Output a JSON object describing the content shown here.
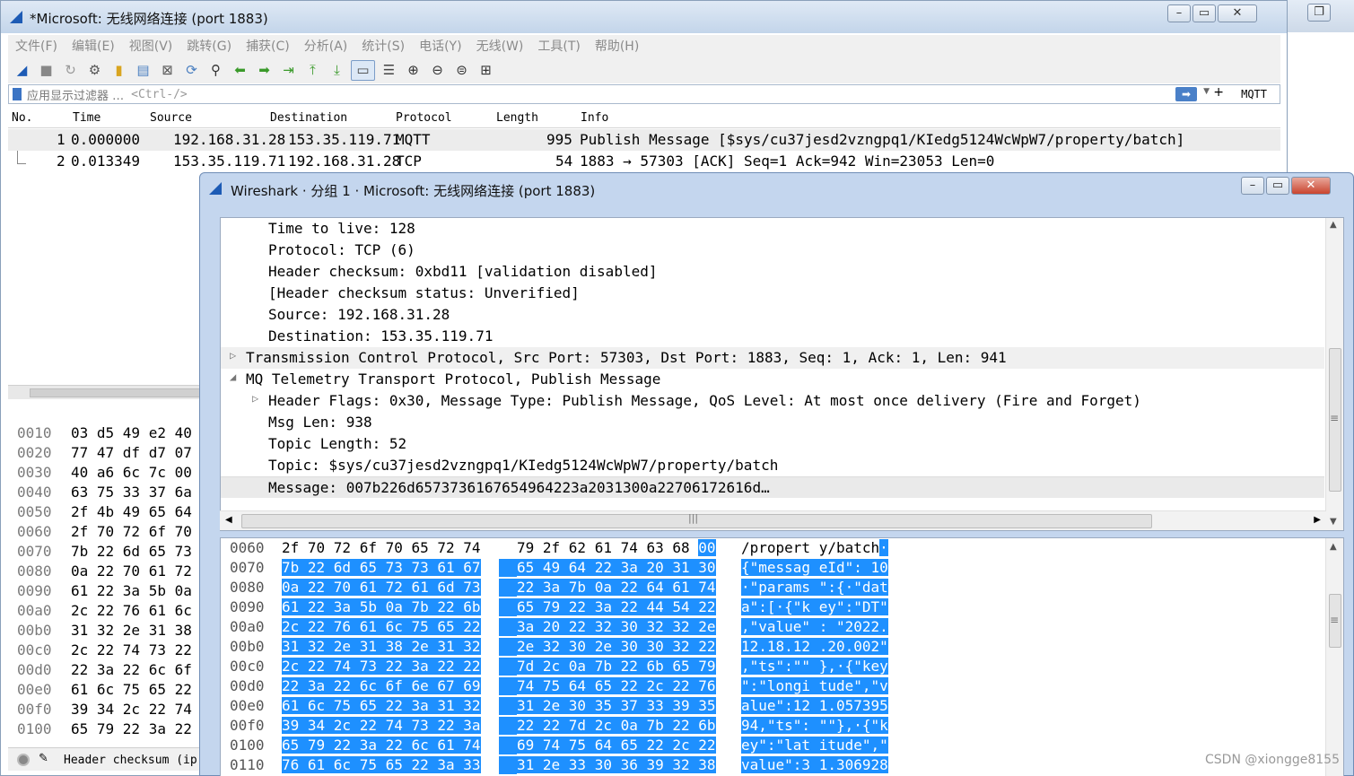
{
  "main_window": {
    "title": "*Microsoft: 无线网络连接 (port 1883)",
    "menu": [
      "文件(F)",
      "编辑(E)",
      "视图(V)",
      "跳转(G)",
      "捕获(C)",
      "分析(A)",
      "统计(S)",
      "电话(Y)",
      "无线(W)",
      "工具(T)",
      "帮助(H)"
    ],
    "filter": {
      "label": "应用显示过滤器 …",
      "placeholder": "<Ctrl-/>",
      "button_label": "MQTT"
    },
    "columns": [
      "No.",
      "Time",
      "Source",
      "Destination",
      "Protocol",
      "Length",
      "Info"
    ],
    "packets": [
      {
        "no": "1",
        "time": "0.000000",
        "source": "192.168.31.28",
        "destination": "153.35.119.71",
        "protocol": "MQTT",
        "length": "995",
        "info": "Publish Message [$sys/cu37jesd2vzngpq1/KIedg5124WcWpW7/property/batch]"
      },
      {
        "no": "2",
        "time": "0.013349",
        "source": "153.35.119.71",
        "destination": "192.168.31.28",
        "protocol": "TCP",
        "length": "54",
        "info": "1883 → 57303 [ACK] Seq=1 Ack=942 Win=23053 Len=0"
      }
    ],
    "bg_hex": [
      {
        "off": "0010",
        "hex": "03 d5 49 e2 40"
      },
      {
        "off": "0020",
        "hex": "77 47 df d7 07"
      },
      {
        "off": "0030",
        "hex": "40 a6 6c 7c 00"
      },
      {
        "off": "0040",
        "hex": "63 75 33 37 6a"
      },
      {
        "off": "0050",
        "hex": "2f 4b 49 65 64"
      },
      {
        "off": "0060",
        "hex": "2f 70 72 6f 70"
      },
      {
        "off": "0070",
        "hex": "7b 22 6d 65 73"
      },
      {
        "off": "0080",
        "hex": "0a 22 70 61 72"
      },
      {
        "off": "0090",
        "hex": "61 22 3a 5b 0a"
      },
      {
        "off": "00a0",
        "hex": "2c 22 76 61 6c"
      },
      {
        "off": "00b0",
        "hex": "31 32 2e 31 38"
      },
      {
        "off": "00c0",
        "hex": "2c 22 74 73 22"
      },
      {
        "off": "00d0",
        "hex": "22 3a 22 6c 6f"
      },
      {
        "off": "00e0",
        "hex": "61 6c 75 65 22"
      },
      {
        "off": "00f0",
        "hex": "39 34 2c 22 74"
      },
      {
        "off": "0100",
        "hex": "65 79 22 3a 22"
      }
    ],
    "status_text": "Header checksum (ip",
    "watermark": "CSDN @xiongge8155"
  },
  "dialog": {
    "title": "Wireshark · 分组 1 · Microsoft: 无线网络连接 (port 1883)",
    "tree": [
      {
        "text": "Time to live: 128",
        "level": 2
      },
      {
        "text": "Protocol: TCP (6)",
        "level": 2
      },
      {
        "text": "Header checksum: 0xbd11 [validation disabled]",
        "level": 2
      },
      {
        "text": "[Header checksum status: Unverified]",
        "level": 2
      },
      {
        "text": "Source: 192.168.31.28",
        "level": 2
      },
      {
        "text": "Destination: 153.35.119.71",
        "level": 2
      },
      {
        "text": "Transmission Control Protocol, Src Port: 57303, Dst Port: 1883, Seq: 1, Ack: 1, Len: 941",
        "level": 1,
        "arrow": "▷"
      },
      {
        "text": "MQ Telemetry Transport Protocol, Publish Message",
        "level": 1,
        "arrow": "◢"
      },
      {
        "text": "Header Flags: 0x30, Message Type: Publish Message, QoS Level: At most once delivery (Fire and Forget)",
        "level": 2,
        "arrow": "▷"
      },
      {
        "text": "Msg Len: 938",
        "level": 2
      },
      {
        "text": "Topic Length: 52",
        "level": 2
      },
      {
        "text": "Topic: $sys/cu37jesd2vzngpq1/KIedg5124WcWpW7/property/batch",
        "level": 2
      },
      {
        "text": "Message: 007b226d6573736167654964223a2031300a22706172616d…",
        "level": 2
      }
    ],
    "bytes": [
      {
        "off": "0060",
        "h1": "2f 70 72 6f 70 65 72 74",
        "h2": "79 2f 62 61 74 63 68 ",
        "h2_tail": "00",
        "asc": "/propert y/batch",
        "asc_tail": "·",
        "hl": false
      },
      {
        "off": "0070",
        "h1": "7b 22 6d 65 73 73 61 67",
        "h2": "65 49 64 22 3a 20 31 30",
        "asc": "{\"messag eId\": 10",
        "hl": true
      },
      {
        "off": "0080",
        "h1": "0a 22 70 61 72 61 6d 73",
        "h2": "22 3a 7b 0a 22 64 61 74",
        "asc": "·\"params \":{·\"dat",
        "hl": true
      },
      {
        "off": "0090",
        "h1": "61 22 3a 5b 0a 7b 22 6b",
        "h2": "65 79 22 3a 22 44 54 22",
        "asc": "a\":[·{\"k ey\":\"DT\"",
        "hl": true
      },
      {
        "off": "00a0",
        "h1": "2c 22 76 61 6c 75 65 22",
        "h2": "3a 20 22 32 30 32 32 2e",
        "asc": ",\"value\" : \"2022.",
        "hl": true
      },
      {
        "off": "00b0",
        "h1": "31 32 2e 31 38 2e 31 32",
        "h2": "2e 32 30 2e 30 30 32 22",
        "asc": "12.18.12 .20.002\"",
        "hl": true
      },
      {
        "off": "00c0",
        "h1": "2c 22 74 73 22 3a 22 22",
        "h2": "7d 2c 0a 7b 22 6b 65 79",
        "asc": ",\"ts\":\"\" },·{\"key",
        "hl": true
      },
      {
        "off": "00d0",
        "h1": "22 3a 22 6c 6f 6e 67 69",
        "h2": "74 75 64 65 22 2c 22 76",
        "asc": "\":\"longi tude\",\"v",
        "hl": true
      },
      {
        "off": "00e0",
        "h1": "61 6c 75 65 22 3a 31 32",
        "h2": "31 2e 30 35 37 33 39 35",
        "asc": "alue\":12 1.057395",
        "hl": true
      },
      {
        "off": "00f0",
        "h1": "39 34 2c 22 74 73 22 3a",
        "h2": "22 22 7d 2c 0a 7b 22 6b",
        "asc": "94,\"ts\": \"\"},·{\"k",
        "hl": true
      },
      {
        "off": "0100",
        "h1": "65 79 22 3a 22 6c 61 74",
        "h2": "69 74 75 64 65 22 2c 22",
        "asc": "ey\":\"lat itude\",\"",
        "hl": true
      },
      {
        "off": "0110",
        "h1": "76 61 6c 75 65 22 3a 33",
        "h2": "31 2e 33 30 36 39 32 38",
        "asc": "value\":3 1.306928",
        "hl": true
      }
    ]
  },
  "colors": {
    "selection": "#1e90ff",
    "title_bar": "#c4d6ee",
    "close_button": "#c9442e"
  }
}
